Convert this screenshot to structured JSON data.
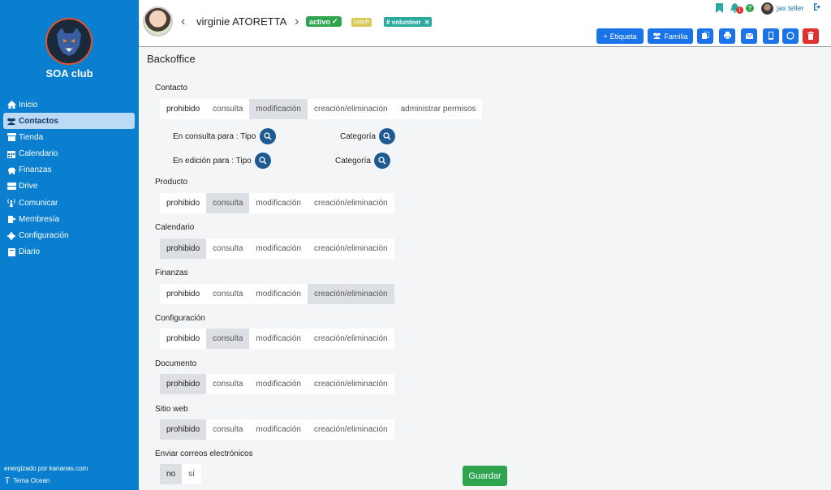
{
  "sidebar": {
    "club_name": "SOA club",
    "items": [
      {
        "label": "Inicio",
        "icon": "home-icon"
      },
      {
        "label": "Contactos",
        "icon": "users-icon"
      },
      {
        "label": "Tienda",
        "icon": "store-icon"
      },
      {
        "label": "Calendario",
        "icon": "calendar-icon"
      },
      {
        "label": "Finanzas",
        "icon": "piggy-bank-icon"
      },
      {
        "label": "Drive",
        "icon": "drive-icon"
      },
      {
        "label": "Comunicar",
        "icon": "broadcast-icon"
      },
      {
        "label": "Membresía",
        "icon": "membership-icon"
      },
      {
        "label": "Configuración",
        "icon": "gear-icon"
      },
      {
        "label": "Diario",
        "icon": "journal-icon"
      }
    ],
    "footer_powered": "energizado por kananas.com",
    "footer_theme": "Tema Ocean"
  },
  "header": {
    "contact_name": "virginie ATORETTA",
    "badge_status": "activo",
    "badge_coach": "coach",
    "badge_volunteer": "# volunteer",
    "user_name": "jax teller",
    "notification_count": "1",
    "help": "?",
    "btn_etiqueta": "Etiqueta",
    "btn_familia": "Familia"
  },
  "main": {
    "title": "Backoffice",
    "sections": [
      {
        "label": "Contacto",
        "options": [
          "prohibido",
          "consulta",
          "modificación",
          "creación/eliminación",
          "administrar permisos"
        ],
        "selected": 2
      },
      {
        "label": "Producto",
        "options": [
          "prohibido",
          "consulta",
          "modificación",
          "creación/eliminación"
        ],
        "selected": 1
      },
      {
        "label": "Calendario",
        "options": [
          "prohibido",
          "consulta",
          "modificación",
          "creación/eliminación"
        ],
        "selected": 0
      },
      {
        "label": "Finanzas",
        "options": [
          "prohibido",
          "consulta",
          "modificación",
          "creación/eliminación"
        ],
        "selected": 3
      },
      {
        "label": "Configuración",
        "options": [
          "prohibido",
          "consulta",
          "modificación",
          "creación/eliminación"
        ],
        "selected": 1
      },
      {
        "label": "Documento",
        "options": [
          "prohibido",
          "consulta",
          "modificación",
          "creación/eliminación"
        ],
        "selected": 0
      },
      {
        "label": "Sitio web",
        "options": [
          "prohibido",
          "consulta",
          "modificación",
          "creación/eliminación"
        ],
        "selected": 0
      },
      {
        "label": "Enviar correos electrónicos",
        "options": [
          "no",
          "sí"
        ],
        "selected": 0
      }
    ],
    "consulta_tipo": "En consulta para : Tipo",
    "consulta_categoria": "Categoría",
    "edicion_tipo": "En edición para : Tipo",
    "edicion_categoria": "Categoría",
    "save_label": "Guardar"
  },
  "colors": {
    "sidebar": "#0a7fd0",
    "primary": "#1a73e8",
    "success": "#2ea44f",
    "danger": "#e03131",
    "teal": "#2aa9a0"
  }
}
